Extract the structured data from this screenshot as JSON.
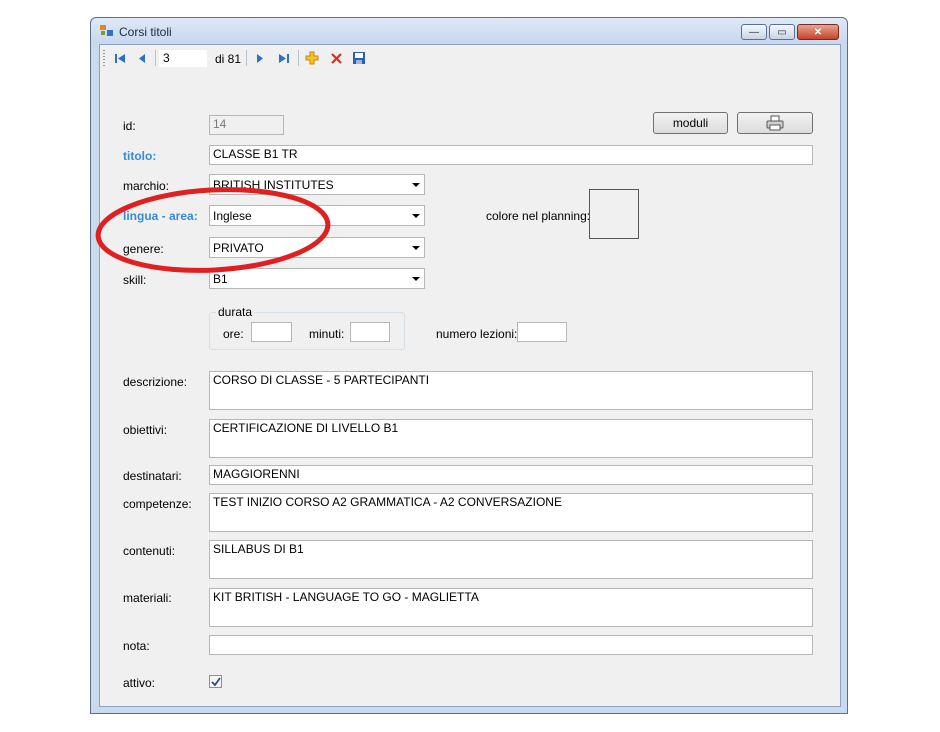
{
  "window": {
    "title": "Corsi titoli",
    "minimize_label": "—",
    "maximize_label": "▭",
    "close_label": "✕"
  },
  "navigator": {
    "position": "3",
    "count_label": "di 81"
  },
  "buttons": {
    "moduli": "moduli"
  },
  "form": {
    "id_label": "id:",
    "id_value": "14",
    "titolo_label": "titolo:",
    "titolo_value": "CLASSE B1 TR",
    "marchio_label": "marchio:",
    "marchio_value": "BRITISH INSTITUTES",
    "lingua_label": "lingua - area:",
    "lingua_value": "Inglese",
    "colore_label": "colore nel planning:",
    "genere_label": "genere:",
    "genere_value": "PRIVATO",
    "skill_label": "skill:",
    "skill_value": "B1",
    "durata_label": "durata",
    "ore_label": "ore:",
    "ore_value": "",
    "minuti_label": "minuti:",
    "minuti_value": "",
    "numero_lezioni_label": "numero lezioni:",
    "numero_lezioni_value": "",
    "descrizione_label": "descrizione:",
    "descrizione_value": "CORSO DI CLASSE - 5 PARTECIPANTI",
    "obiettivi_label": "obiettivi:",
    "obiettivi_value": "CERTIFICAZIONE DI LIVELLO B1",
    "destinatari_label": "destinatari:",
    "destinatari_value": "MAGGIORENNI",
    "competenze_label": "competenze:",
    "competenze_value": "TEST INIZIO CORSO A2 GRAMMATICA - A2 CONVERSAZIONE",
    "contenuti_label": "contenuti:",
    "contenuti_value": "SILLABUS DI B1",
    "materiali_label": "materiali:",
    "materiali_value": "KIT BRITISH - LANGUAGE TO GO - MAGLIETTA",
    "nota_label": "nota:",
    "nota_value": "",
    "attivo_label": "attivo:",
    "attivo_checked": true
  },
  "colors": {
    "accent_label": "#3a8ad8",
    "annotation_ellipse": "#e02020"
  }
}
